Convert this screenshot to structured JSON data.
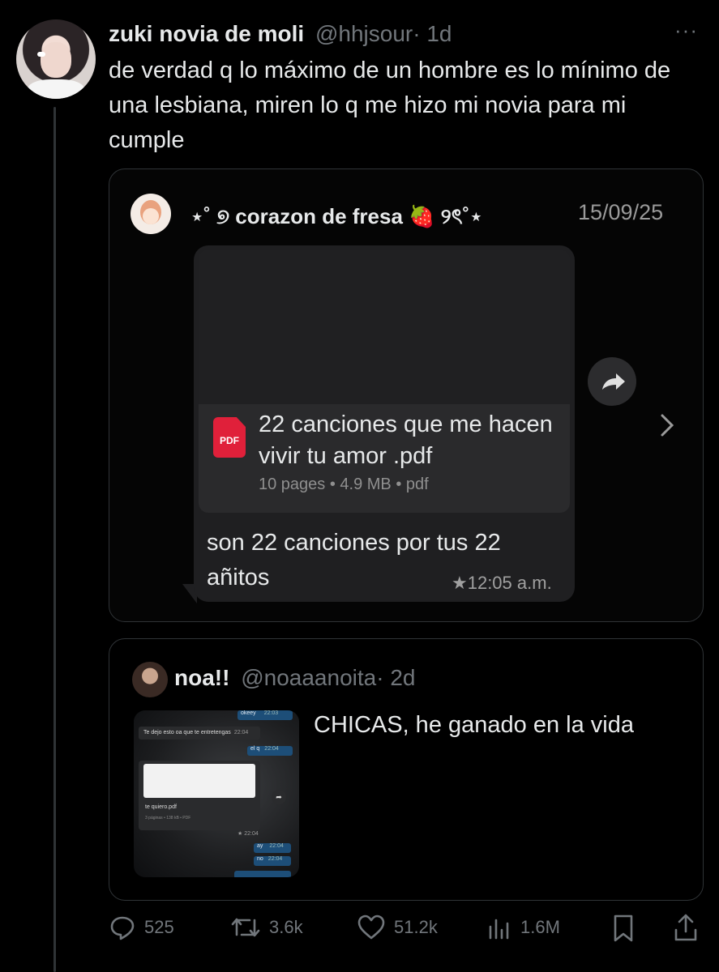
{
  "tweet": {
    "display_name": "zuki novia de moli",
    "handle": "@hhjsour",
    "time": "· 1d",
    "more_label": "···",
    "text": "de verdad q lo máximo de un hombre es lo mínimo de una lesbiana, miren lo q me hizo mi novia para mi cumple"
  },
  "chat": {
    "contact_name": "⋆˚ ୭ corazon de fresa 🍓 ୨ৎ˚⋆",
    "date": "15/09/25",
    "file_name": "22 canciones que me hacen vivir tu amor .pdf",
    "file_meta": "10 pages • 4.9 MB • pdf",
    "pdf_badge": "PDF",
    "message": "son 22 canciones por tus 22 añitos",
    "message_time": "★12:05 a.m."
  },
  "quote": {
    "display_name": "noa!!",
    "handle": "@noaaanoita",
    "time": "· 2d",
    "text": "CHICAS, he ganado en la vida",
    "thumb": {
      "msg_top": "okeey",
      "msg_top_time": "22:03",
      "msg_left": "Te dejo esto oa que te entretengas",
      "msg_left_time": "22:04",
      "msg_elq": "el q",
      "msg_elq_time": "22:04",
      "file_name": "te quiero.pdf",
      "file_meta": "3 páginas • 138 kB • PDF",
      "file_time": "★ 22:04",
      "msg_ay": "ay",
      "msg_ay_time": "22:04",
      "msg_no": "no",
      "msg_no_time": "22:04"
    }
  },
  "actions": {
    "replies": "525",
    "retweets": "3.6k",
    "likes": "51.2k",
    "views": "1.6M"
  },
  "colors": {
    "background": "#000000",
    "text": "#e7e9ea",
    "muted": "#71767b",
    "border": "#2f3336",
    "pdf_red": "#e0203a"
  }
}
